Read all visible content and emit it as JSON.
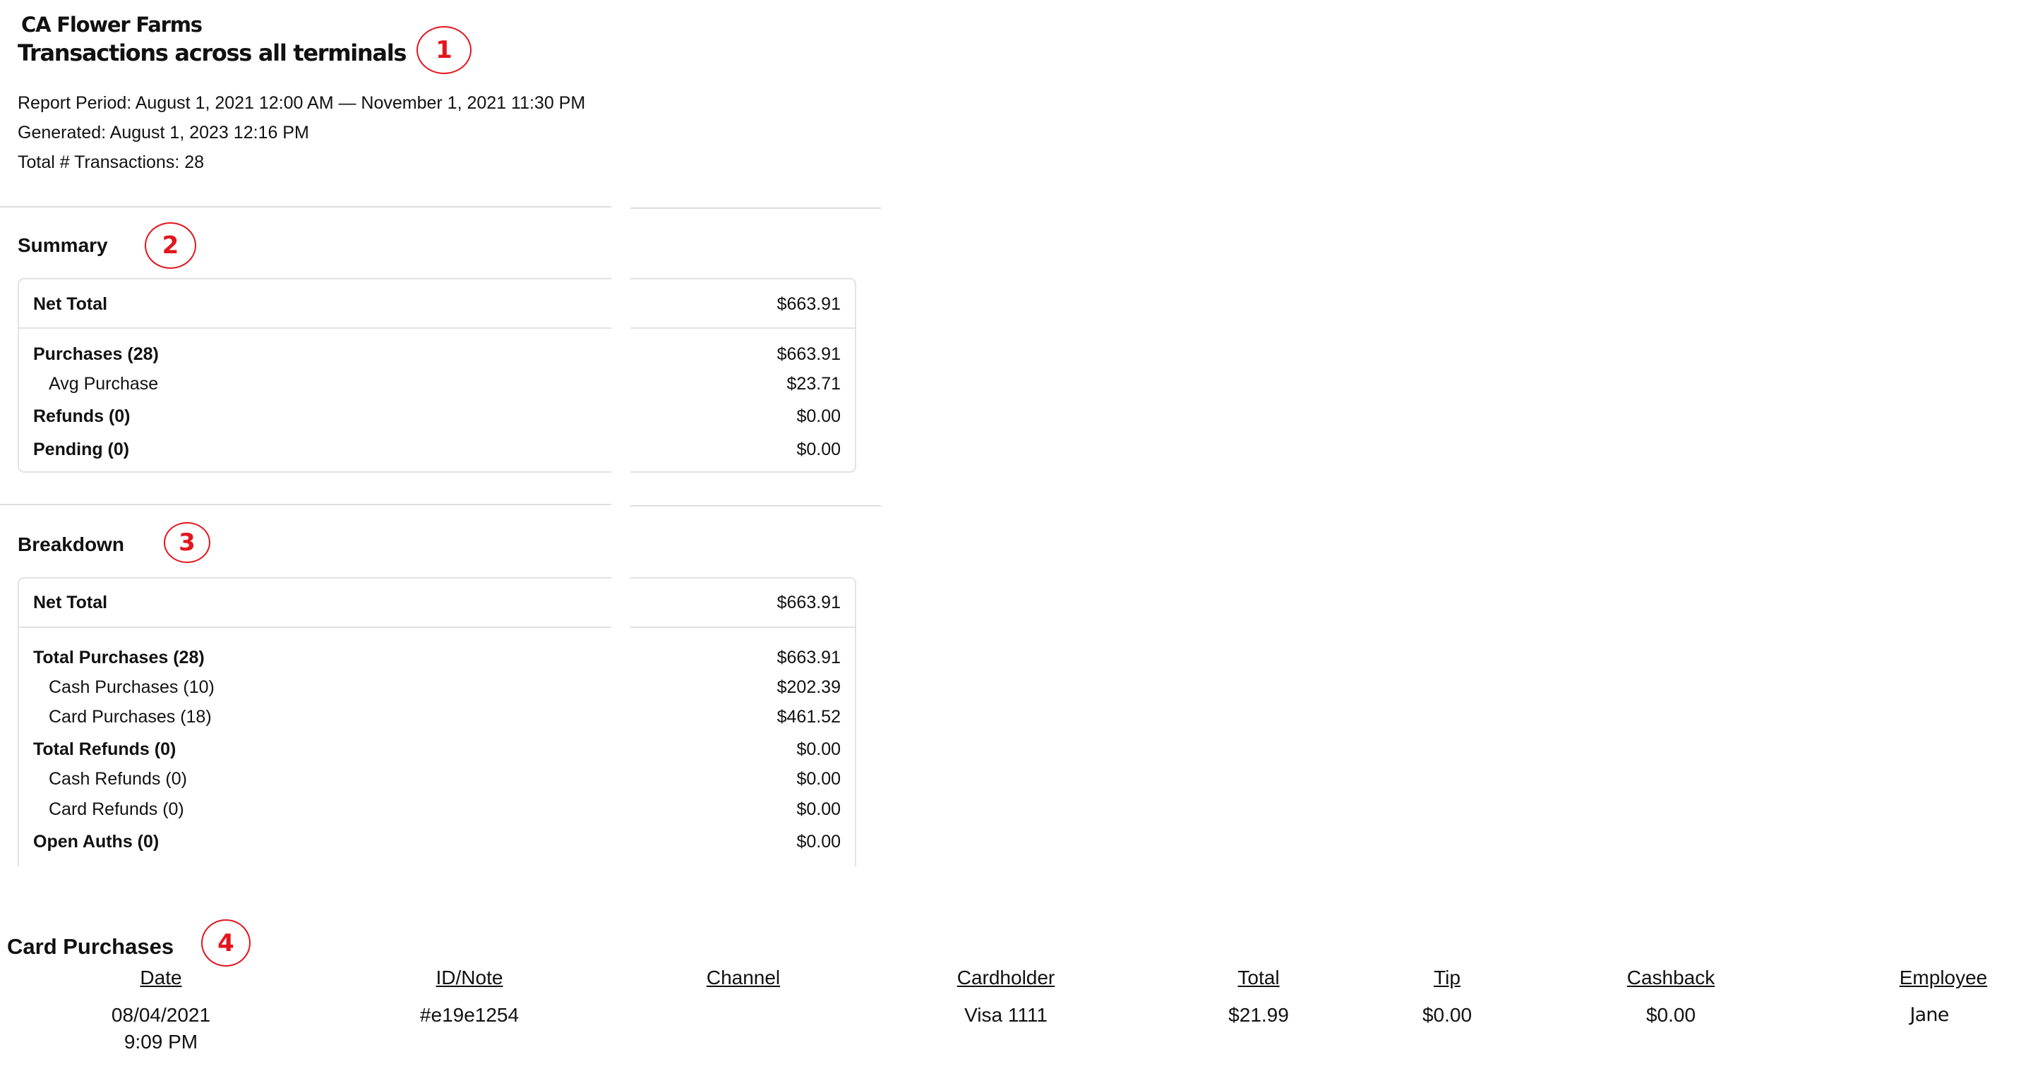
{
  "header": {
    "org_name": "CA Flower Farms",
    "title": "Transactions across all terminals",
    "report_period": "Report Period: August 1, 2021 12:00 AM — November 1, 2021 11:30 PM",
    "generated": "Generated: August 1, 2023 12:16 PM",
    "total_transactions": "Total # Transactions: 28"
  },
  "annotations": [
    "1",
    "2",
    "3",
    "4"
  ],
  "annotation_color": "#e3161e",
  "summary": {
    "heading": "Summary",
    "net_total": {
      "label": "Net Total",
      "value": "$663.91"
    },
    "rows": [
      {
        "label": "Purchases (28)",
        "value": "$663.91",
        "style": "bold"
      },
      {
        "label": "Avg Purchase",
        "value": "$23.71",
        "style": "sub"
      },
      {
        "label": "Refunds (0)",
        "value": "$0.00",
        "style": "bold"
      },
      {
        "label": "Pending (0)",
        "value": "$0.00",
        "style": "bold"
      }
    ]
  },
  "breakdown": {
    "heading": "Breakdown",
    "net_total": {
      "label": "Net Total",
      "value": "$663.91"
    },
    "rows": [
      {
        "label": "Total Purchases (28)",
        "value": "$663.91",
        "style": "bold"
      },
      {
        "label": "Cash Purchases (10)",
        "value": "$202.39",
        "style": "sub"
      },
      {
        "label": "Card Purchases (18)",
        "value": "$461.52",
        "style": "sub"
      },
      {
        "label": "Total Refunds (0)",
        "value": "$0.00",
        "style": "bold"
      },
      {
        "label": "Cash Refunds (0)",
        "value": "$0.00",
        "style": "sub"
      },
      {
        "label": "Card Refunds (0)",
        "value": "$0.00",
        "style": "sub"
      },
      {
        "label": "Open Auths (0)",
        "value": "$0.00",
        "style": "bold"
      }
    ]
  },
  "card_purchases": {
    "heading": "Card Purchases",
    "columns": [
      "Date",
      "ID/Note",
      "Channel",
      "Cardholder",
      "Total",
      "Tip",
      "Cashback",
      "Employee"
    ],
    "rows": [
      {
        "date": "08/04/2021",
        "time": "9:09 PM",
        "id_note": "#e19e1254",
        "channel": "",
        "cardholder": "Visa 1111",
        "total": "$21.99",
        "tip": "$0.00",
        "cashback": "$0.00",
        "employee": "Jane"
      }
    ]
  }
}
